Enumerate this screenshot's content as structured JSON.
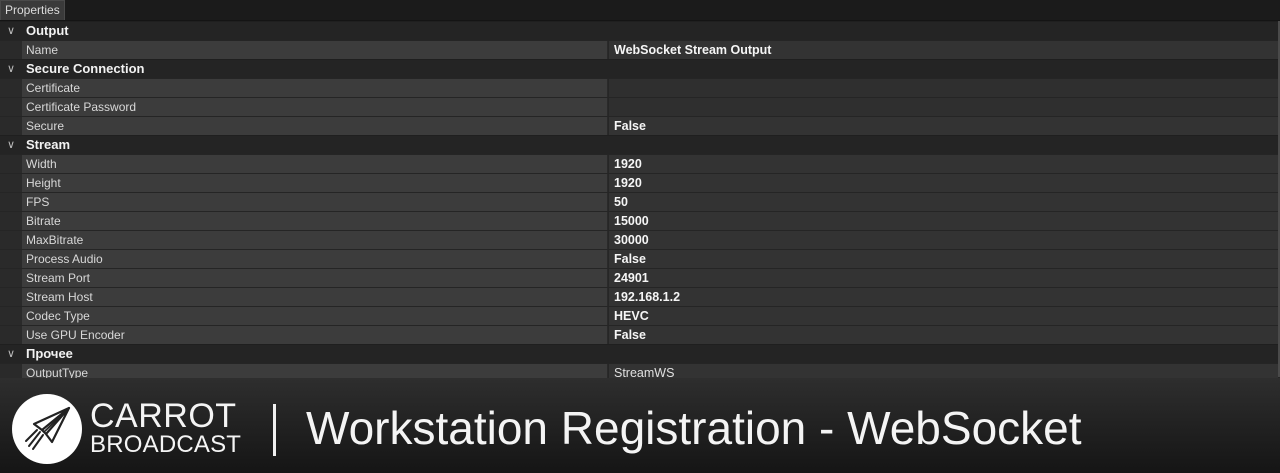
{
  "window": {
    "tab_label": "Properties"
  },
  "grid": {
    "categories": [
      {
        "label": "Output",
        "rows": [
          {
            "name": "Name",
            "value": "WebSocket Stream Output",
            "bold": true
          }
        ]
      },
      {
        "label": "Secure Connection",
        "rows": [
          {
            "name": "Certificate",
            "value": "",
            "bold": true
          },
          {
            "name": "Certificate Password",
            "value": "",
            "bold": true
          },
          {
            "name": "Secure",
            "value": "False",
            "bold": true
          }
        ]
      },
      {
        "label": "Stream",
        "rows": [
          {
            "name": "Width",
            "value": "1920",
            "bold": true
          },
          {
            "name": "Height",
            "value": "1920",
            "bold": true
          },
          {
            "name": "FPS",
            "value": "50",
            "bold": true
          },
          {
            "name": "Bitrate",
            "value": "15000",
            "bold": true
          },
          {
            "name": "MaxBitrate",
            "value": "30000",
            "bold": true
          },
          {
            "name": "Process Audio",
            "value": "False",
            "bold": true
          },
          {
            "name": "Stream Port",
            "value": "24901",
            "bold": true
          },
          {
            "name": "Stream Host",
            "value": "192.168.1.2",
            "bold": true
          },
          {
            "name": "Codec Type",
            "value": "HEVC",
            "bold": true
          },
          {
            "name": "Use GPU Encoder",
            "value": "False",
            "bold": true
          }
        ]
      },
      {
        "label": "Прочее",
        "rows": [
          {
            "name": "OutputType",
            "value": "StreamWS",
            "bold": false
          }
        ]
      }
    ],
    "chevron_icon": "chevron-down-icon"
  },
  "banner": {
    "brand_line1": "CARROT",
    "brand_line2": "BROADCAST",
    "divider": "|",
    "headline": "Workstation Registration - WebSocket",
    "logo_icon": "rocket-icon"
  }
}
